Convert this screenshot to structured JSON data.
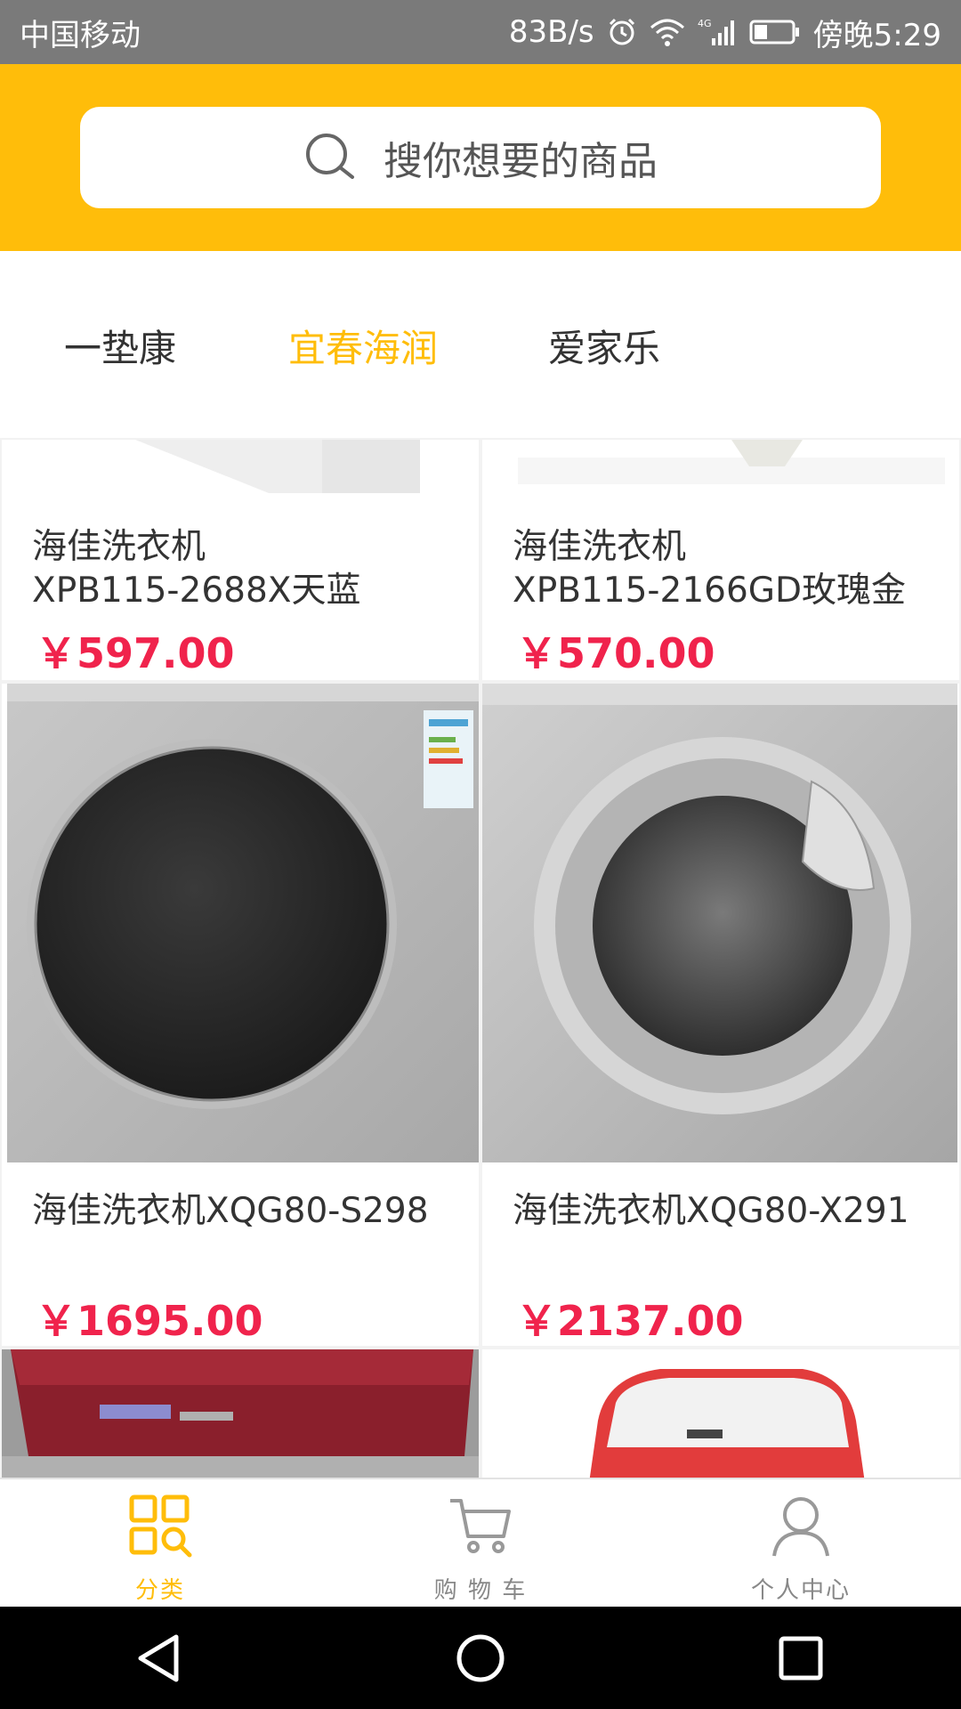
{
  "status_bar": {
    "carrier": "中国移动",
    "speed": "83B/s",
    "time": "傍晚5:29"
  },
  "search": {
    "placeholder": "搜你想要的商品"
  },
  "tabs": [
    {
      "label": "一垫康",
      "active": false
    },
    {
      "label": "宜春海润",
      "active": true
    },
    {
      "label": "爱家乐",
      "active": false
    }
  ],
  "products": [
    {
      "title_line1": "海佳洗衣机",
      "title_line2": "XPB115-2688X天蓝",
      "price": "￥597.00"
    },
    {
      "title_line1": "海佳洗衣机",
      "title_line2": "XPB115-2166GD玫瑰金",
      "price": "￥570.00"
    },
    {
      "title_line1": "海佳洗衣机XQG80-S298",
      "title_line2": "",
      "price": "￥1695.00"
    },
    {
      "title_line1": "海佳洗衣机XQG80-X291",
      "title_line2": "",
      "price": "￥2137.00"
    }
  ],
  "bottom_nav": [
    {
      "label": "分类",
      "icon": "category-icon",
      "active": true
    },
    {
      "label": "购 物 车",
      "icon": "cart-icon",
      "active": false
    },
    {
      "label": "个人中心",
      "icon": "user-icon",
      "active": false
    }
  ],
  "colors": {
    "accent": "#ffbd0a",
    "price": "#f0234c",
    "status_bar": "#7a7a7a"
  }
}
